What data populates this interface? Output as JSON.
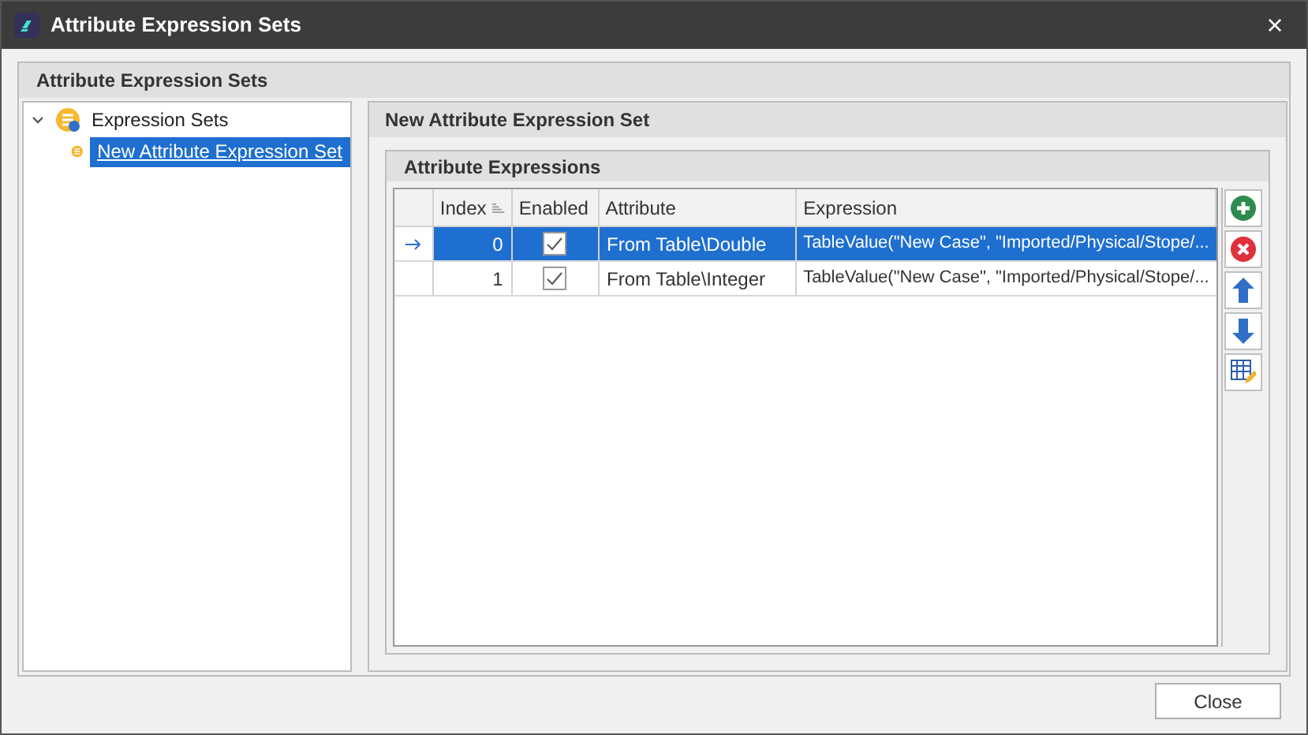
{
  "window": {
    "title": "Attribute Expression Sets",
    "close": "×"
  },
  "group": {
    "title": "Attribute Expression Sets"
  },
  "tree": [
    {
      "label": "Expression Sets",
      "expanded": true,
      "selected": false,
      "children": [
        {
          "label": "New Attribute Expression Set",
          "selected": true
        }
      ]
    }
  ],
  "detail": {
    "title": "New Attribute Expression Set",
    "section": "Attribute Expressions"
  },
  "table": {
    "columns": [
      "Index",
      "Enabled",
      "Attribute",
      "Expression"
    ],
    "rows": [
      {
        "index": "0",
        "enabled": true,
        "attribute": "From Table\\Double",
        "expression": "TableValue(\"New Case\", \"Imported/Physical/Stope/...",
        "selected": true
      },
      {
        "index": "1",
        "enabled": true,
        "attribute": "From Table\\Integer",
        "expression": "TableValue(\"New Case\", \"Imported/Physical/Stope/...",
        "selected": false
      }
    ]
  },
  "side_buttons": [
    {
      "kind": "add"
    },
    {
      "kind": "remove"
    },
    {
      "kind": "up"
    },
    {
      "kind": "down"
    },
    {
      "kind": "edit"
    }
  ],
  "buttons": [
    "Close"
  ]
}
